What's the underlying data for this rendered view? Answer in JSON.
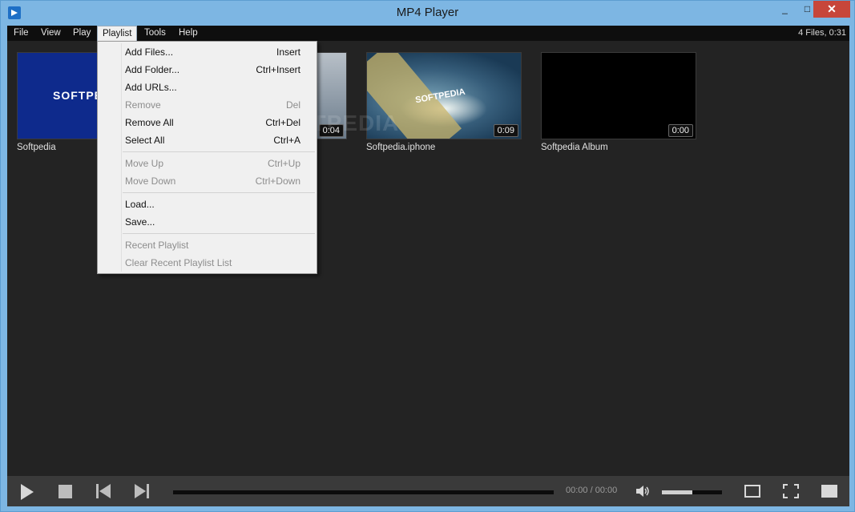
{
  "window": {
    "title": "MP4 Player",
    "controls": {
      "minimize": "_",
      "maximize": "□",
      "close": "✕"
    }
  },
  "menubar": {
    "items": [
      "File",
      "View",
      "Play",
      "Playlist",
      "Tools",
      "Help"
    ],
    "active": "Playlist",
    "status": "4 Files, 0:31"
  },
  "playlist": {
    "items": [
      {
        "label": "Softpedia",
        "duration": "",
        "logo": "SOFTPE"
      },
      {
        "label": "",
        "duration": "0:04"
      },
      {
        "label": "Softpedia.iphone",
        "duration": "0:09",
        "logo": "SOFTPEDIA"
      },
      {
        "label": "Softpedia Album",
        "duration": "0:00"
      }
    ]
  },
  "playlist_menu": {
    "groups": [
      [
        {
          "label": "Add Files...",
          "shortcut": "Insert",
          "enabled": true
        },
        {
          "label": "Add Folder...",
          "shortcut": "Ctrl+Insert",
          "enabled": true
        },
        {
          "label": "Add URLs...",
          "shortcut": "",
          "enabled": true
        },
        {
          "label": "Remove",
          "shortcut": "Del",
          "enabled": false
        },
        {
          "label": "Remove All",
          "shortcut": "Ctrl+Del",
          "enabled": true
        },
        {
          "label": "Select All",
          "shortcut": "Ctrl+A",
          "enabled": true
        }
      ],
      [
        {
          "label": "Move Up",
          "shortcut": "Ctrl+Up",
          "enabled": false
        },
        {
          "label": "Move Down",
          "shortcut": "Ctrl+Down",
          "enabled": false
        }
      ],
      [
        {
          "label": "Load...",
          "shortcut": "",
          "enabled": true
        },
        {
          "label": "Save...",
          "shortcut": "",
          "enabled": true
        }
      ],
      [
        {
          "label": "Recent Playlist",
          "shortcut": "",
          "enabled": false
        },
        {
          "label": "Clear Recent Playlist List",
          "shortcut": "",
          "enabled": false
        }
      ]
    ]
  },
  "controls": {
    "time": "00:00 / 00:00",
    "seek_progress": 0,
    "volume_level": 0.5,
    "icons": [
      "play-icon",
      "stop-icon",
      "previous-icon",
      "next-icon",
      "volume-icon",
      "window-mode-icon",
      "fullscreen-icon",
      "playlist-toggle-icon"
    ]
  },
  "watermark": "SOFTPEDIA"
}
